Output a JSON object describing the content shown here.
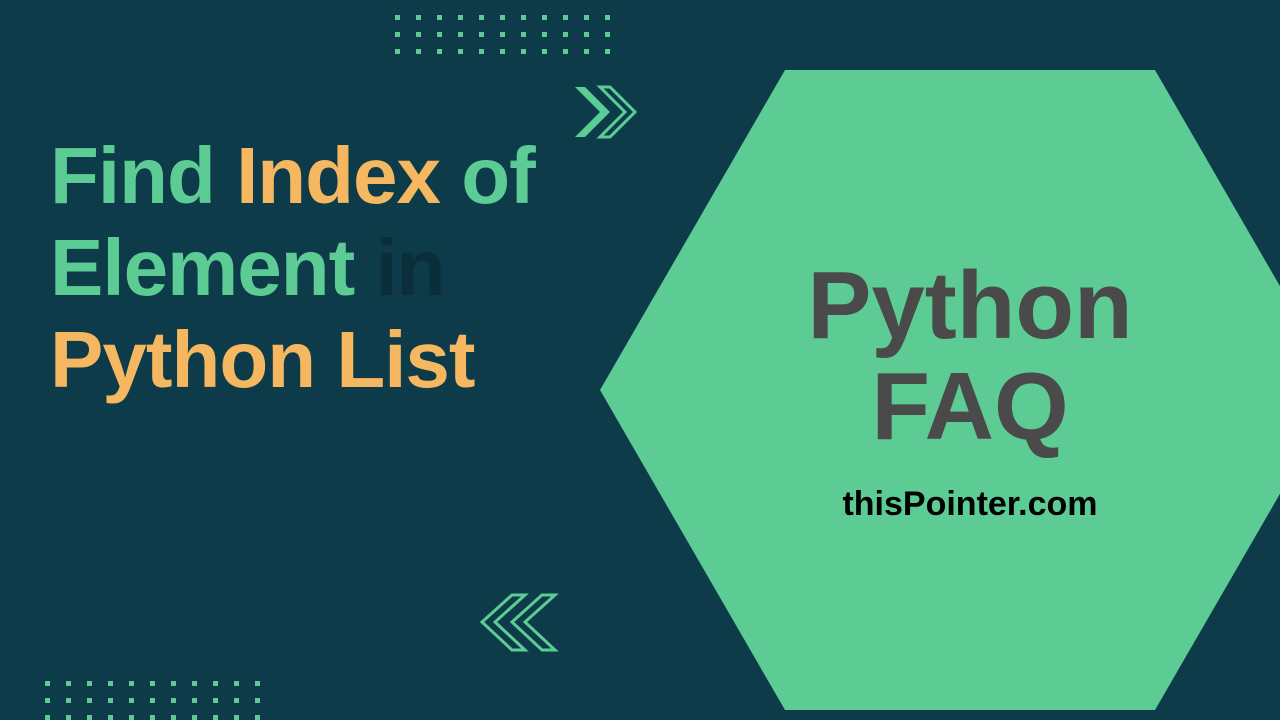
{
  "heading": {
    "w1": "Find",
    "w2": "Index",
    "w3": "of",
    "w4": "Element",
    "w5": "in",
    "w6": "Python",
    "w7": "List"
  },
  "hex": {
    "line1": "Python",
    "line2": "FAQ",
    "sub": "thisPointer.com"
  },
  "colors": {
    "bg": "#0d3b4a",
    "green": "#5ccc94",
    "yellow": "#f5b760",
    "text_dark": "#4a4a4a"
  }
}
